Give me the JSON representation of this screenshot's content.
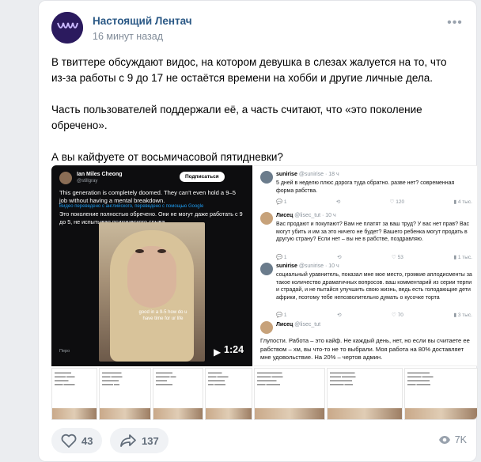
{
  "post": {
    "author": "Настоящий Лентач",
    "time": "16 минут назад",
    "paragraphs": [
      "В твиттере обсуждают видос, на котором девушка в слезах жалуется на то, что из-за работы с 9 до 17 не остаётся времени на хобби и другие личные дела.",
      "Часть пользователей поддержали её, а часть считают, что «это поколение обречено».",
      "А вы кайфуете от восьмичасовой пятидневки?"
    ]
  },
  "video": {
    "tweet_name": "Ian Miles Cheong",
    "tweet_handle": "@stillgray",
    "subscribe": "Подписаться",
    "tweet_text": "This generation is completely doomed. They can't even hold a 9–5 job without having a mental breakdown.",
    "translate_note": "Видео переведено с английского, переведено с помощью Google",
    "tweet_ru": "Это поколение полностью обречено. Они не могут даже работать с 9 до 5, не испытывая психического срыва.",
    "caption": "good in a 9-5 how do u have time for ur life",
    "duration": "1:24",
    "bottom_label": "Перо"
  },
  "comments": [
    {
      "name": "sunirise",
      "meta": "@sunirise · 18 ч",
      "text": "5 дней в неделю плюс дорога туда обратно. разве нет? современная форма рабства.",
      "stats": [
        "1",
        "",
        "120",
        "4 тыс."
      ]
    },
    {
      "name": "Лисец",
      "meta": "@lisec_tut · 10 ч",
      "text": "Вас продают и покупают? Вам не платят за ваш труд? У вас нет прав? Вас могут убить и им за это ничего не будет? Вашего ребенка могут продать в другую страну? Если нет – вы не в рабстве, поздравляю.",
      "stats": [
        "1",
        "",
        "53",
        "1 тыс."
      ]
    },
    {
      "name": "sunirise",
      "meta": "@sunirise · 10 ч",
      "text": "социальный уравнитель, показал мне мое место, громкие аплодисменты за такое количество драматичных вопросов. ваш комментарий из серии терпи и страдай, и не пытайся улучшить свою жизнь, ведь есть голодающие дети африки, поэтому тебе непозволительно думать о кусочке торта",
      "stats": [
        "1",
        "",
        "70",
        "3 тыс."
      ]
    },
    {
      "name": "Лисец",
      "meta": "@lisec_tut",
      "text": "Глупости. Работа – это кайф. Не каждый день, нет, но если вы считаете ее рабством – хм, вы что-то не то выбрали. Моя работа на 80% доставляет мне удовольствие. На 20% – чертов админ.",
      "stats": []
    }
  ],
  "footer": {
    "likes": "43",
    "shares": "137",
    "views": "7K"
  },
  "colors": {
    "author": "#2a5885",
    "muted": "#818c99",
    "pill_bg": "#f0f2f5"
  }
}
